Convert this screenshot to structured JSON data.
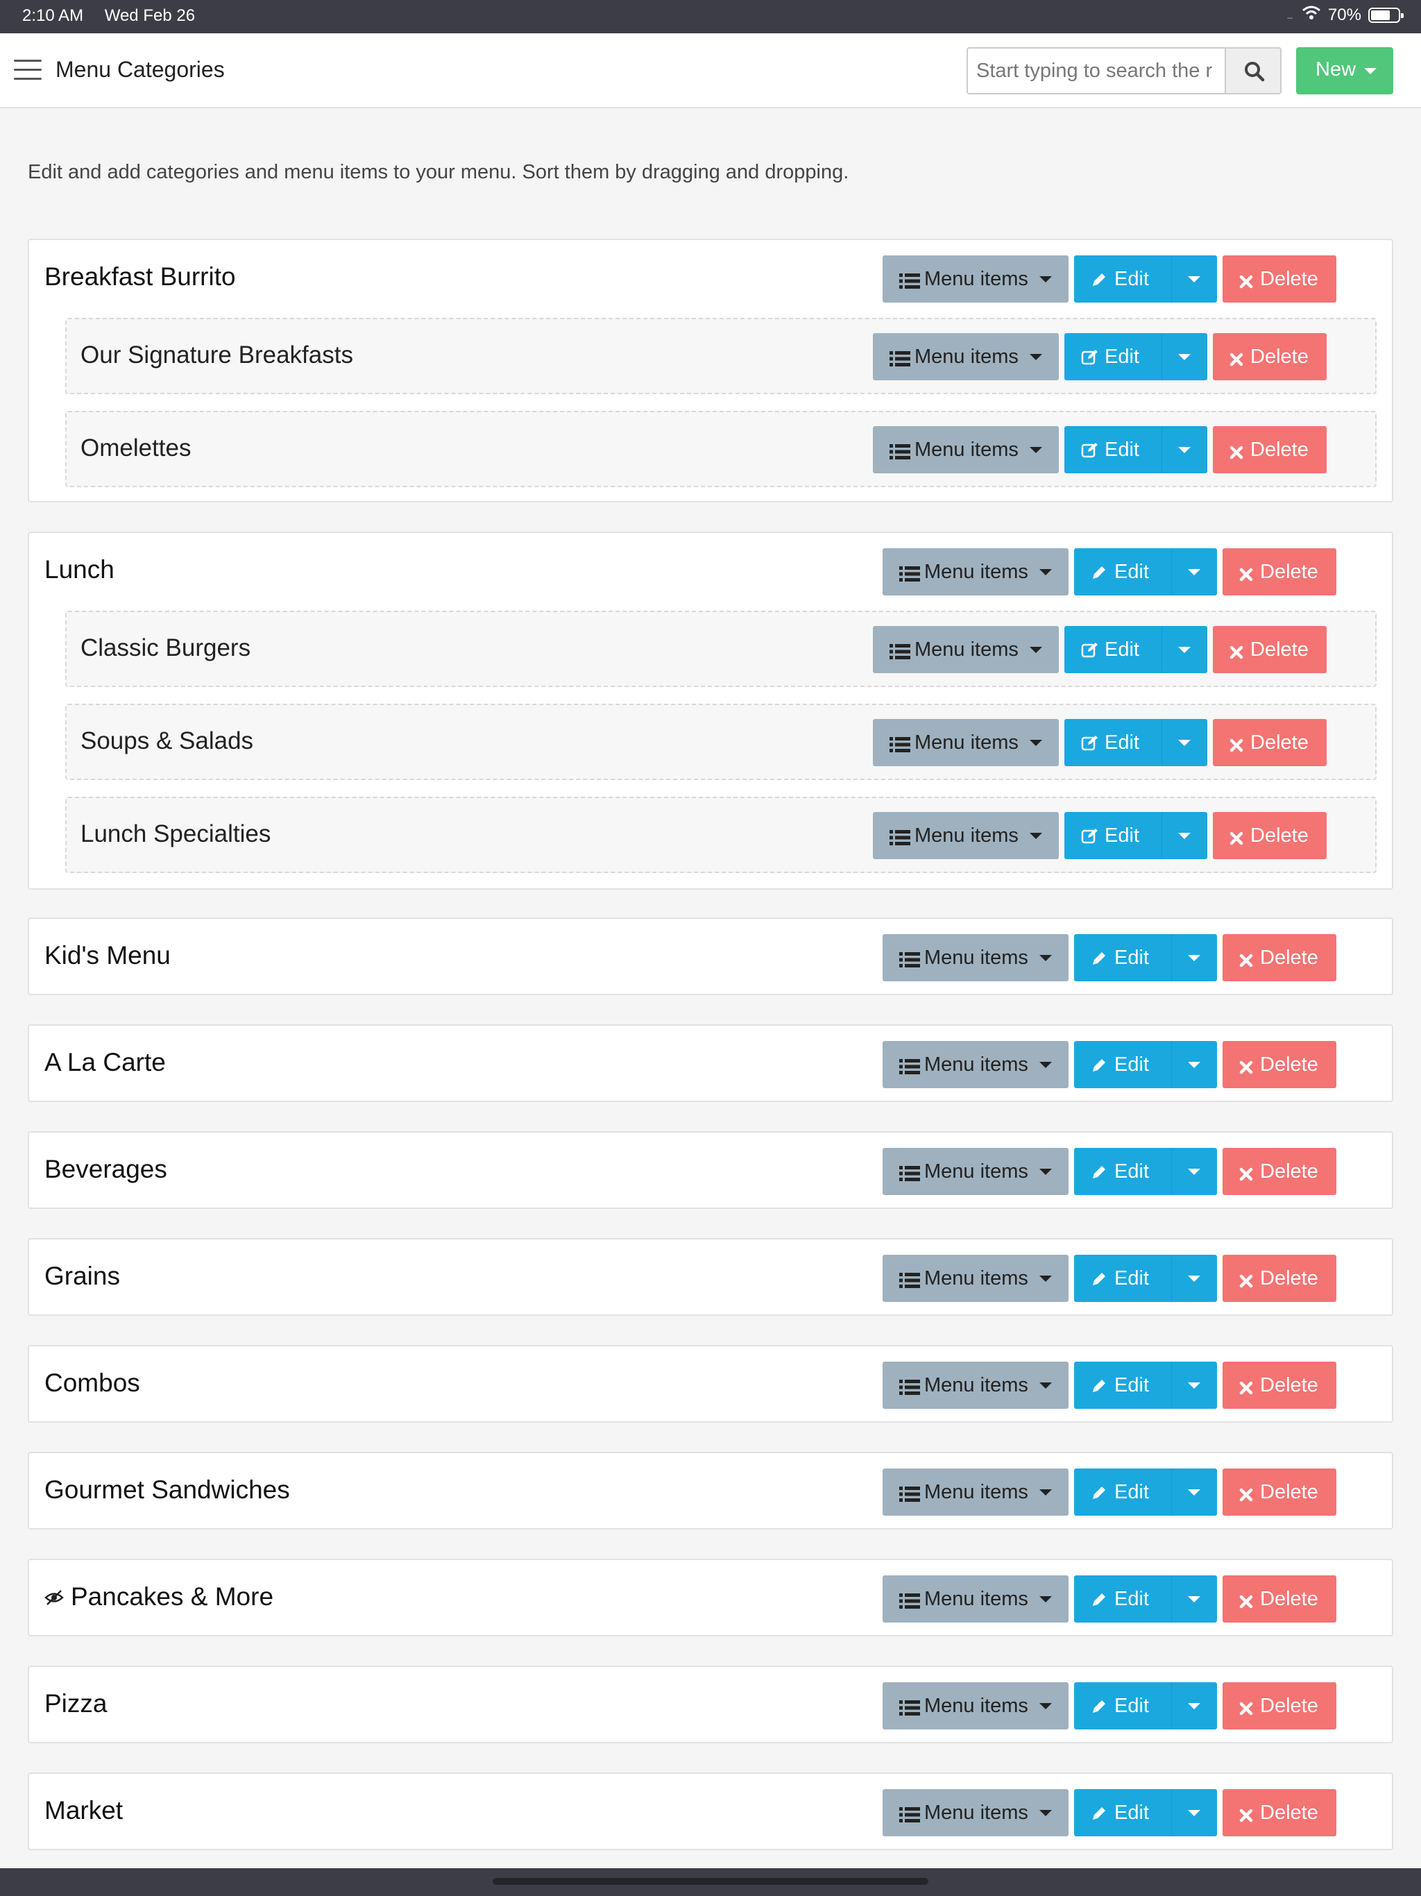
{
  "status_bar": {
    "time": "2:10 AM",
    "date": "Wed Feb 26",
    "signal": "....",
    "battery": "70%",
    "battery_level": 0.7
  },
  "navbar": {
    "title": "Menu Categories",
    "search_placeholder": "Start typing to search the r",
    "new_label": "New"
  },
  "intro": "Edit and add categories and menu items to your menu. Sort them by dragging and dropping.",
  "labels": {
    "menu_items": "Menu items",
    "edit": "Edit",
    "delete": "Delete"
  },
  "categories": [
    {
      "name": "Breakfast Burrito",
      "children": [
        {
          "name": "Our Signature Breakfasts"
        },
        {
          "name": "Omelettes"
        }
      ]
    },
    {
      "name": "Lunch",
      "children": [
        {
          "name": "Classic Burgers"
        },
        {
          "name": "Soups & Salads"
        },
        {
          "name": "Lunch Specialties"
        }
      ]
    },
    {
      "name": "Kid's Menu"
    },
    {
      "name": "A La Carte"
    },
    {
      "name": "Beverages"
    },
    {
      "name": "Grains"
    },
    {
      "name": "Combos"
    },
    {
      "name": "Gourmet Sandwiches"
    },
    {
      "name": "Pancakes & More",
      "hidden": true
    },
    {
      "name": "Pizza"
    },
    {
      "name": "Market"
    }
  ],
  "colors": {
    "menu_items_button": "#9fb1bf",
    "edit_button": "#1aa8df",
    "delete_button": "#f47373",
    "new_button": "#50c77a"
  },
  "icons": {
    "menu": "list-icon",
    "edit_top": "pencil-icon",
    "edit_sub": "edit-square-icon",
    "delete": "times-icon",
    "hidden": "eye-slash-icon",
    "search": "search-icon",
    "nav": "hamburger-icon"
  }
}
